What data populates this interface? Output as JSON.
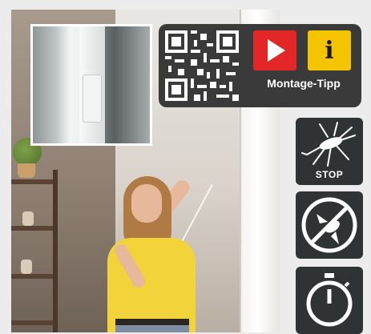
{
  "panel": {
    "caption": "Montage-Tipp",
    "video_icon": "play-video-icon",
    "info_icon": "info-icon",
    "qr_icon": "qr-code-icon",
    "video_color": "#e32626",
    "info_color": "#f5c400",
    "info_glyph": "i"
  },
  "features": [
    {
      "icon": "mosquito-icon",
      "label": "STOP"
    },
    {
      "icon": "no-flying-insects-icon",
      "label": ""
    },
    {
      "icon": "stopwatch-icon",
      "label": ""
    }
  ],
  "colors": {
    "panel_bg": "#3a3a3a",
    "feature_bg": "#2f3333"
  }
}
